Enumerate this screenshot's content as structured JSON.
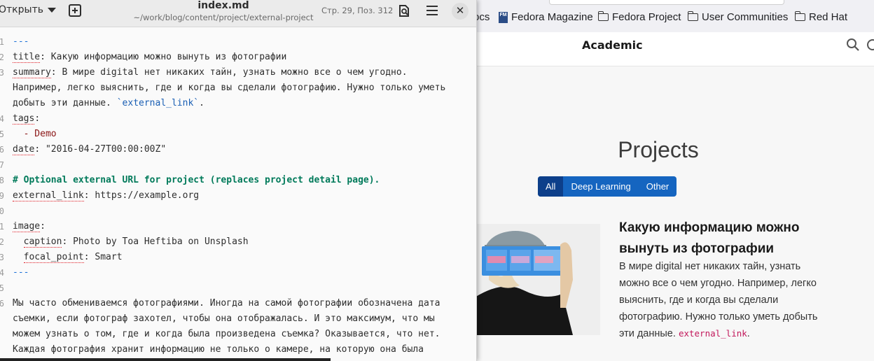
{
  "editor": {
    "open_label": "Открыть",
    "doc_title": "index.md",
    "doc_path": "~/work/blog/content/project/external-project",
    "cursor_position": "Стр. 29, Поз. 312",
    "close_glyph": "✕",
    "lines": [
      {
        "n": "1",
        "text": "---"
      },
      {
        "n": "2",
        "key": "title",
        "rest": ": Какую информацию можно вынуть из фотографии"
      },
      {
        "n": "3",
        "key": "summary",
        "rest": ": В мире digital нет никаких тайн, узнать можно все о чем угодно."
      },
      {
        "n": "",
        "text": "Например, легко выяснить, где и когда вы сделали фотографию. Нужно только уметь"
      },
      {
        "n": "",
        "text": "добыть эти данные. ",
        "code": "`external_link`",
        "tail": "."
      },
      {
        "n": "4",
        "key": "tags",
        "rest": ":"
      },
      {
        "n": "5",
        "list": "  - Demo"
      },
      {
        "n": "6",
        "key": "date",
        "rest": ": \"2016-04-27T00:00:00Z\""
      },
      {
        "n": "7",
        "text": ""
      },
      {
        "n": "8",
        "heading": "# Optional external URL for project (replaces project detail page)."
      },
      {
        "n": "9",
        "key": "external_link",
        "rest": ": https://example.org"
      },
      {
        "n": "0",
        "text": ""
      },
      {
        "n": "1",
        "key": "image",
        "rest": ":"
      },
      {
        "n": "2",
        "key": "  caption",
        "rest": ": Photo by Toa Heftiba on Unsplash"
      },
      {
        "n": "3",
        "key": "  focal_point",
        "rest": ": Smart"
      },
      {
        "n": "4",
        "text": "---"
      },
      {
        "n": "5",
        "text": ""
      },
      {
        "n": "6",
        "para": "Мы часто обмениваемся фотографиями. Иногда на самой фотографии обозначена дата"
      },
      {
        "n": "",
        "para": "съемки, если фотограф захотел, чтобы она отображалась. И это максимум, что мы"
      },
      {
        "n": "",
        "para": "можем узнать о том, где и когда была произведена съемка? Оказывается, что нет."
      },
      {
        "n": "",
        "para": "Каждая фотография хранит информацию не только о камере, на которую она была"
      }
    ]
  },
  "browser": {
    "bookmarks": [
      {
        "label": "ocs",
        "icon": "none-icon"
      },
      {
        "label": "Fedora Magazine",
        "icon": "fedora-magazine-icon"
      },
      {
        "label": "Fedora Project",
        "icon": "folder-icon"
      },
      {
        "label": "User Communities",
        "icon": "folder-icon"
      },
      {
        "label": "Red Hat",
        "icon": "folder-icon"
      }
    ],
    "site_title": "Academic",
    "projects_heading": "Projects",
    "filters": [
      "All",
      "Deep Learning",
      "Other"
    ],
    "project": {
      "title": "Какую информацию можно вынуть из фотографии",
      "summary": "В мире digital нет никаких тайн, узнать можно все о чем угодно. Например, легко выяснить, где и когда вы сделали фотографию. Нужно только уметь добыть эти данные.",
      "summary_code": "external_link",
      "summary_end": "."
    }
  },
  "colors": {
    "filter_bg": "#1565c0",
    "filter_active": "#0d3f8a",
    "heading_green": "#007a5a",
    "code_pink": "#c2185b"
  }
}
